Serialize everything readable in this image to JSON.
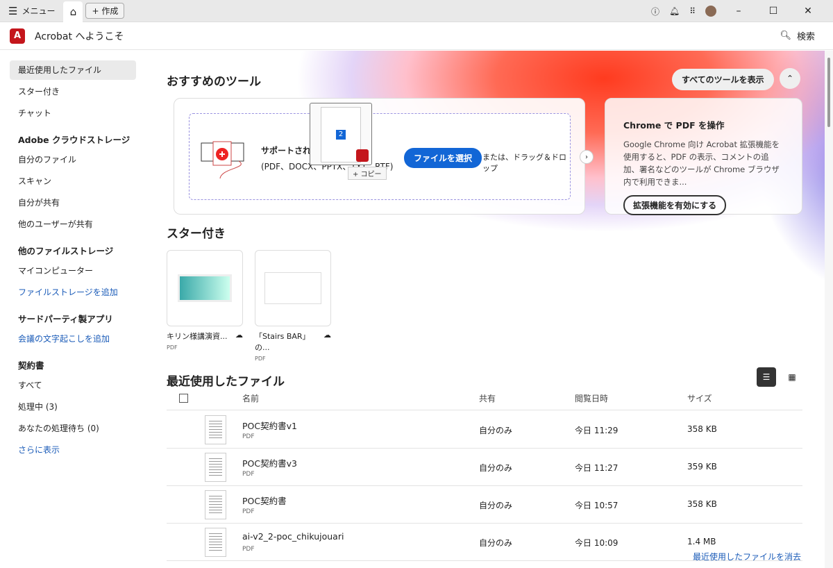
{
  "titlebar": {
    "menu": "メニュー",
    "create": "作成"
  },
  "app": {
    "title": "Acrobat へようこそ",
    "search": "検索",
    "logo_color": "#c4161c"
  },
  "sidebar": {
    "top": [
      "最近使用したファイル",
      "スター付き",
      "チャット"
    ],
    "cloud_head": "Adobe クラウドストレージ",
    "cloud": [
      "自分のファイル",
      "スキャン",
      "自分が共有",
      "他のユーザーが共有"
    ],
    "other_head": "他のファイルストレージ",
    "other": [
      "マイコンピューター"
    ],
    "other_link": "ファイルストレージを追加",
    "third_head": "サードパーティ製アプリ",
    "third_link": "会議の文字起こしを追加",
    "contract_head": "契約書",
    "contract": [
      "すべて",
      "処理中 (3)",
      "あなたの処理待ち (0)"
    ],
    "more": "さらに表示"
  },
  "tools": {
    "title": "おすすめのツール",
    "show_all": "すべてのツールを表示",
    "drop_title": "サポートされて",
    "drop_sub": "(PDF、DOCX、PPTX、TXT、RTF)",
    "select": "ファイルを選択",
    "or": "または、ドラッグ＆ドロップ",
    "drag_page": "2",
    "copy": "+ コピー",
    "chrome_title": "Chrome で PDF を操作",
    "chrome_desc": "Google Chrome 向け Acrobat 拡張機能を使用すると、PDF の表示、コメントの追加、署名などのツールが Chrome ブラウザ内で利用できま...",
    "chrome_btn": "拡張機能を有効にする"
  },
  "starred": {
    "title": "スター付き",
    "items": [
      {
        "name": "キリン様講演資...",
        "type": "PDF"
      },
      {
        "name": "「Stairs BAR」の...",
        "type": "PDF"
      }
    ]
  },
  "recent": {
    "title": "最近使用したファイル",
    "cols": [
      "名前",
      "共有",
      "閲覧日時",
      "サイズ"
    ],
    "rows": [
      {
        "name": "POC契約書v1",
        "type": "PDF",
        "share": "自分のみ",
        "date": "今日 11:29",
        "size": "358 KB"
      },
      {
        "name": "POC契約書v3",
        "type": "PDF",
        "share": "自分のみ",
        "date": "今日 11:27",
        "size": "359 KB"
      },
      {
        "name": "POC契約書",
        "type": "PDF",
        "share": "自分のみ",
        "date": "今日 10:57",
        "size": "358 KB"
      },
      {
        "name": "ai-v2_2-poc_chikujouari",
        "type": "PDF",
        "share": "自分のみ",
        "date": "今日 10:09",
        "size": "1.4 MB"
      }
    ],
    "clear": "最近使用したファイルを消去"
  }
}
